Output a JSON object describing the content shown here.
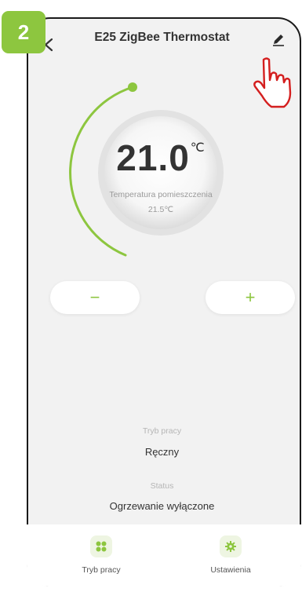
{
  "step_badge": "2",
  "header": {
    "title": "E25 ZigBee Thermostat"
  },
  "thermostat": {
    "setpoint": "21.0",
    "setpoint_unit": "℃",
    "room_label": "Temperatura pomieszczenia",
    "room_value": "21.5℃"
  },
  "controls": {
    "minus": "−",
    "plus": "+"
  },
  "info": {
    "mode_label": "Tryb pracy",
    "mode_value": "Ręczny",
    "status_label": "Status",
    "status_value": "Ogrzewanie wyłączone"
  },
  "bottom_nav": {
    "left_label": "Tryb pracy",
    "right_label": "Ustawienia"
  },
  "colors": {
    "accent": "#8dc63f",
    "background": "#f2f2f2"
  },
  "icons": {
    "back": "chevron-left-icon",
    "edit": "pencil-icon",
    "hand": "pointing-hand-icon",
    "mode": "grid-icon",
    "settings": "gear-icon"
  }
}
